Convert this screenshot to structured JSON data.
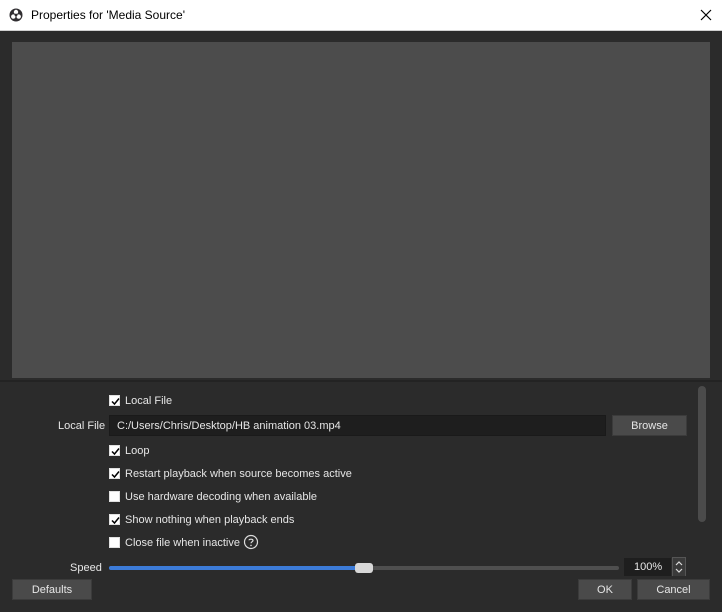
{
  "window": {
    "title": "Properties for 'Media Source'"
  },
  "form": {
    "local_file_checkbox": {
      "label": "Local File",
      "checked": true
    },
    "local_file_field": {
      "label": "Local File",
      "value": "C:/Users/Chris/Desktop/HB animation 03.mp4"
    },
    "browse_label": "Browse",
    "loop": {
      "label": "Loop",
      "checked": true
    },
    "restart": {
      "label": "Restart playback when source becomes active",
      "checked": true
    },
    "hw_decoding": {
      "label": "Use hardware decoding when available",
      "checked": false
    },
    "show_nothing": {
      "label": "Show nothing when playback ends",
      "checked": true
    },
    "close_inactive": {
      "label": "Close file when inactive",
      "checked": false
    },
    "speed": {
      "label": "Speed",
      "value_text": "100%",
      "fraction": 0.5
    }
  },
  "buttons": {
    "defaults": "Defaults",
    "ok": "OK",
    "cancel": "Cancel"
  },
  "colors": {
    "background": "#2b2b2b",
    "preview": "#4c4c4c",
    "accent": "#3c7bd8"
  },
  "icons": {
    "app": "obs-icon",
    "close": "close-icon",
    "help": "help-circle-icon"
  }
}
